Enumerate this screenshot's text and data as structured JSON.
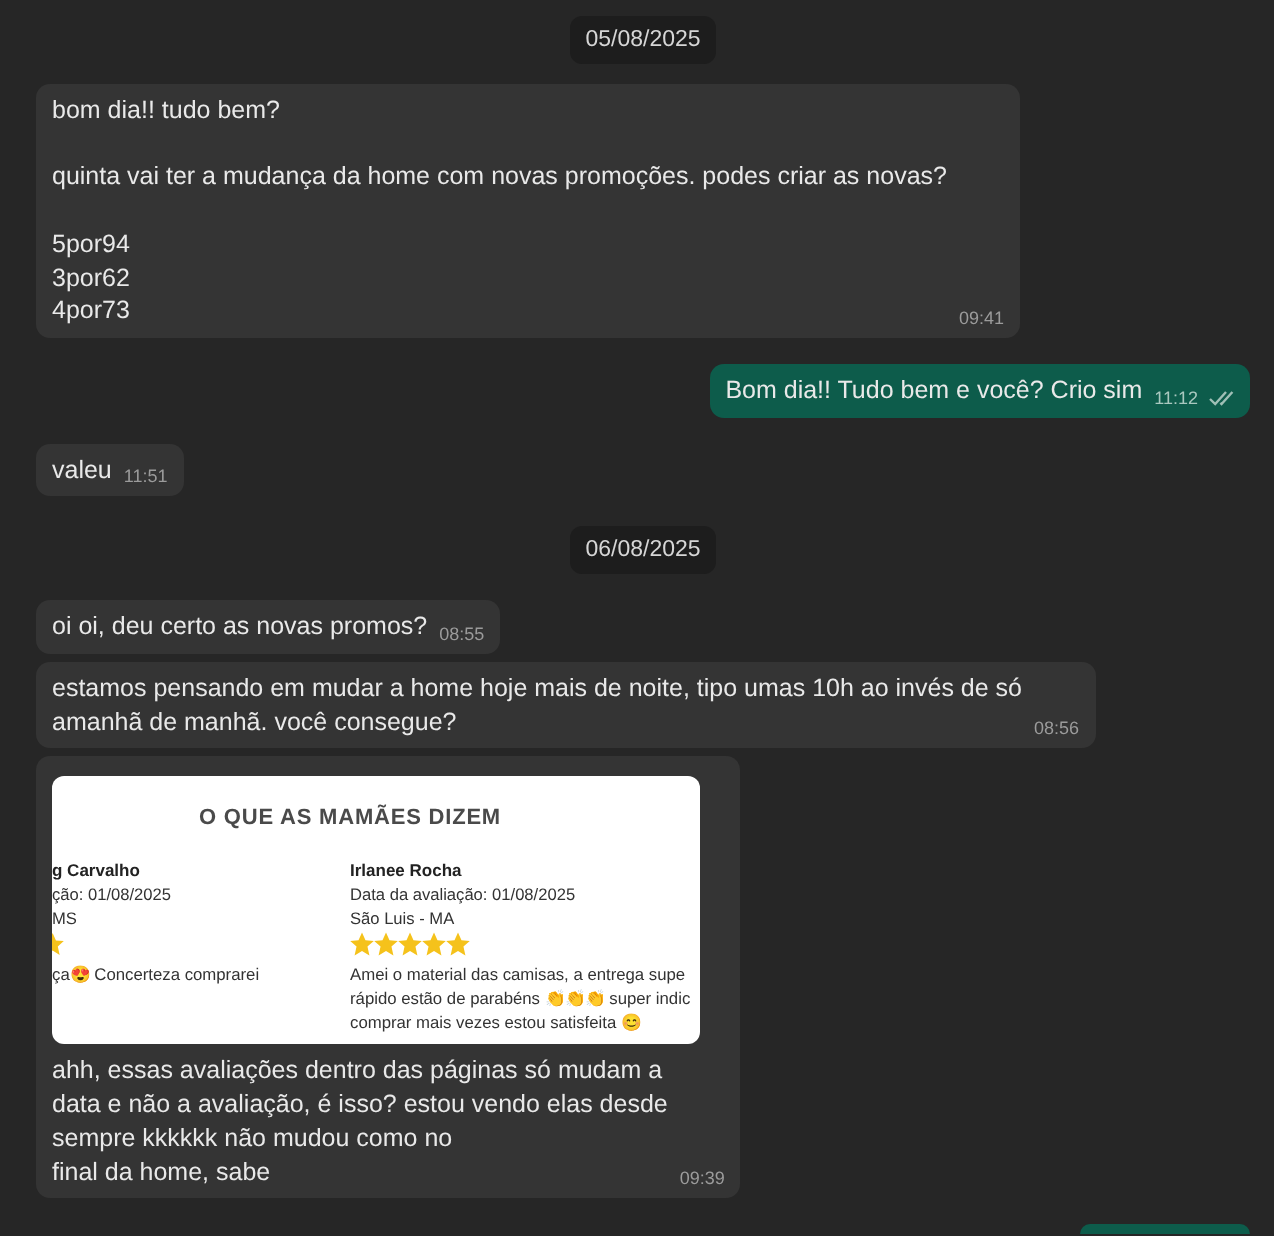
{
  "chat": [
    {
      "kind": "date",
      "text": "05/08/2025"
    },
    {
      "kind": "incoming",
      "text": "bom dia!! tudo bem?\n\nquinta vai ter a mudança da home com novas promoções. podes criar as novas?\n\n5por94\n3por62\n4por73",
      "time": "09:41"
    },
    {
      "kind": "outgoing",
      "text": "Bom dia!! Tudo bem e você? Crio sim",
      "time": "11:12",
      "read": false
    },
    {
      "kind": "incoming",
      "text": "valeu",
      "time": "11:51"
    },
    {
      "kind": "date",
      "text": "06/08/2025"
    },
    {
      "kind": "incoming",
      "text": "oi oi, deu certo as novas promos?",
      "time": "08:55"
    },
    {
      "kind": "incoming",
      "text": "estamos pensando em mudar a home hoje mais de noite, tipo umas 10h ao invés de só\namanhã de manhã. você consegue?",
      "time": "08:56"
    },
    {
      "kind": "incoming",
      "attachment": {
        "kind": "screenshot",
        "title": "O QUE AS MAMÃES DIZEM",
        "reviews": [
          {
            "kind": "cropped",
            "name": "g Carvalho",
            "date": "ção: 01/08/2025",
            "location": "MS",
            "text": "ça😍 Concerteza comprarei"
          },
          {
            "kind": "full",
            "name": "Irlanee Rocha",
            "date": "Data da avaliação: 01/08/2025",
            "location": "São Luis - MA",
            "stars": 5,
            "text": "Amei o material das camisas, a entrega supe\nrápido estão de parabéns 👏👏👏 super indic\ncomprar mais vezes estou satisfeita 😊"
          }
        ]
      },
      "text": "ahh, essas avaliações dentro das páginas só mudam a\ndata e não a avaliação, é isso? estou vendo elas desde\nsempre kkkkkk não mudou como no\nfinal da home, sabe",
      "time": "09:39"
    },
    {
      "kind": "outgoing"
    }
  ]
}
